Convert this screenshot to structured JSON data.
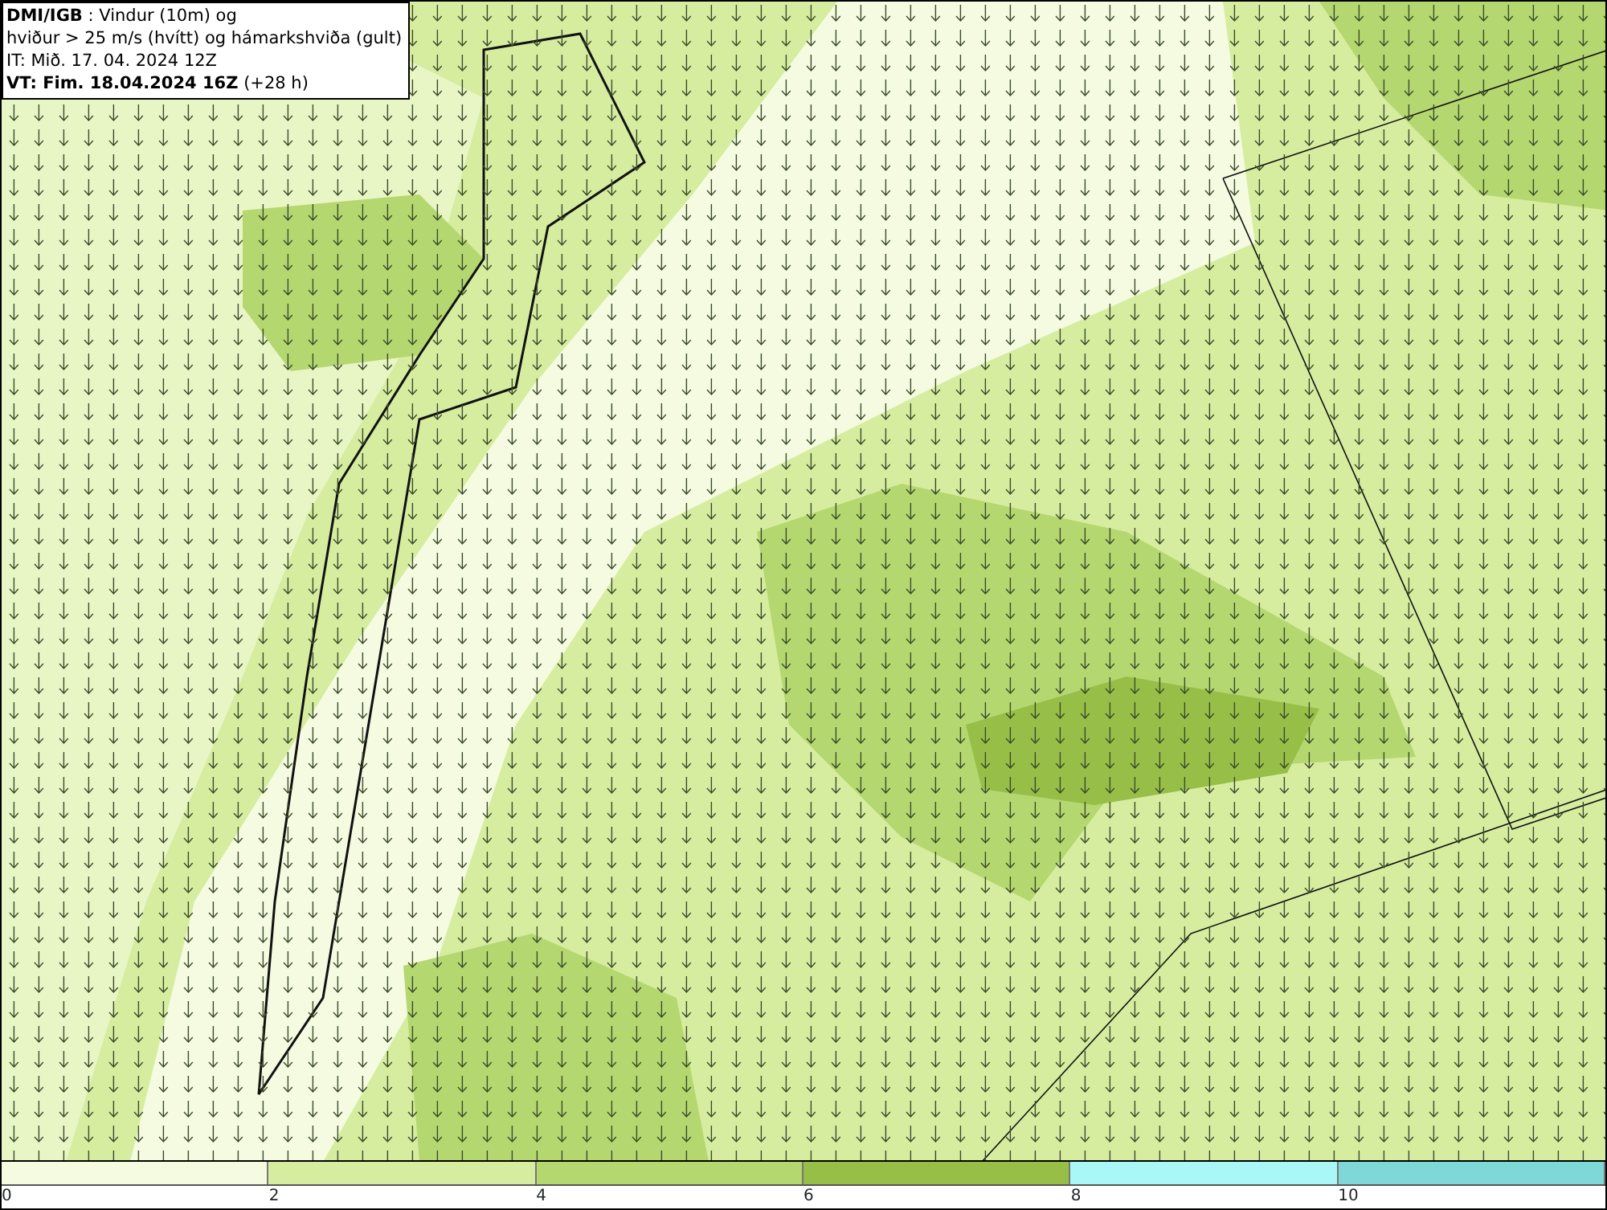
{
  "info_box": {
    "lines": [
      "**DMI/IGB** : Vindur (10m) og",
      "hviður > 25 m/s (hvítt) og hámarkshviða (gult)",
      "IT: Mið. 17. 04. 2024 12Z",
      "**VT: Fim. 18.04.2024 16Z** (+28 h)"
    ]
  },
  "legend": [
    {
      "label": "0",
      "color": "#f4fbe0"
    },
    {
      "label": "2",
      "color": "#d6eda0"
    },
    {
      "label": "4",
      "color": "#b5d770"
    },
    {
      "label": "6",
      "color": "#97bf48"
    },
    {
      "label": "8",
      "color": "#aaf7f7"
    },
    {
      "label": "10",
      "color": "#7fd7d7"
    }
  ]
}
